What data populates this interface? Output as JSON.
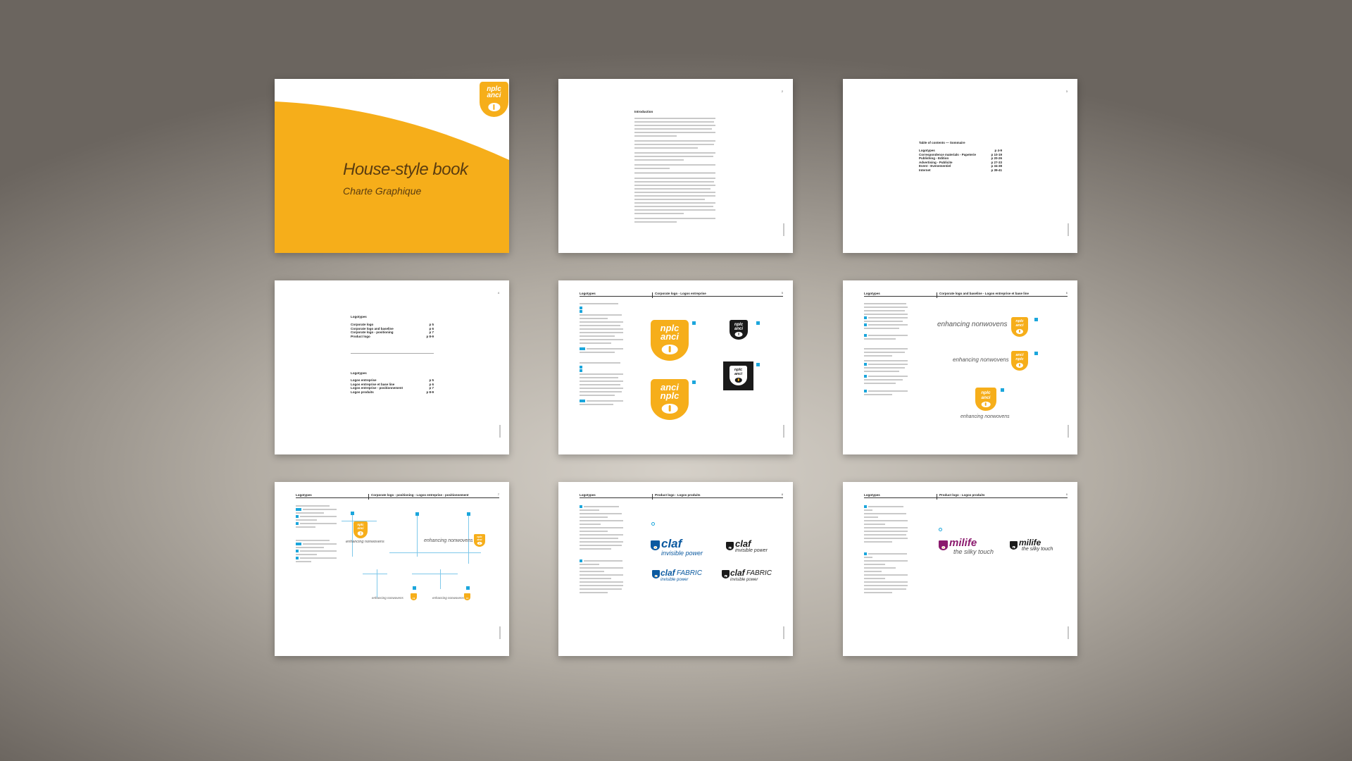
{
  "cover": {
    "title": "House-style book",
    "subtitle": "Charte Graphique",
    "logo_top": "nplc",
    "logo_bottom": "anci",
    "accent": "#f6ae1a"
  },
  "intro": {
    "page": "2",
    "heading": "Introduction"
  },
  "toc": {
    "page": "3",
    "heading": "Table of contents — Sommaire",
    "items": [
      {
        "label": "Logotypes",
        "pages": "p 4-9"
      },
      {
        "label": "Correspondence materials - Papeterie",
        "pages": "p 10-19"
      },
      {
        "label": "Publishing - Edition",
        "pages": "p 20-26"
      },
      {
        "label": "Advertising - Publicite",
        "pages": "p 27-33"
      },
      {
        "label": "Event - Evenementiel",
        "pages": "p 34-38"
      },
      {
        "label": "Internet",
        "pages": "p 39-41"
      }
    ]
  },
  "logotypes_index": {
    "page": "4",
    "heading_en": "Logotypes",
    "items_en": [
      {
        "label": "Corporate logo",
        "pages": "p 5"
      },
      {
        "label": "Corporate logo and baseline",
        "pages": "p 6"
      },
      {
        "label": "Corporate logo - positioning",
        "pages": "p 7"
      },
      {
        "label": "Product logo",
        "pages": "p 8-9"
      }
    ],
    "heading_fr": "Logotypes",
    "items_fr": [
      {
        "label": "Logos entreprise",
        "pages": "p 5"
      },
      {
        "label": "Logos entreprise et base line",
        "pages": "p 6"
      },
      {
        "label": "Logos entreprise - positionnement",
        "pages": "p 7"
      },
      {
        "label": "Logos produits",
        "pages": "p 8-9"
      }
    ]
  },
  "corporate": {
    "page": "5",
    "left": "Logotypes",
    "right": "Corporate logo - Logos entreprise",
    "logo_a_top": "nplc",
    "logo_a_bottom": "anci",
    "logo_b_top": "anci",
    "logo_b_bottom": "nplc"
  },
  "baseline": {
    "page": "6",
    "left": "Logotypes",
    "right": "Corporate logo and baseline - Logos entreprise et base line",
    "tagline": "enhancing nonwovens"
  },
  "positioning": {
    "page": "7",
    "left": "Logotypes",
    "right": "Corporate logo - positioning - Logos entreprise - positionnement",
    "tagline": "enhancing nonwovens"
  },
  "product1": {
    "page": "8",
    "left": "Logotypes",
    "right": "Product logo - Logos produits",
    "brand": "claf",
    "brand_sub": "invisible power",
    "brand_fabric": "FABRIC",
    "brand_color": "#0c5aa0"
  },
  "product2": {
    "page": "9",
    "left": "Logotypes",
    "right": "Product logo - Logos produits",
    "brand": "milife",
    "brand_sub": "the silky touch",
    "brand_color": "#8b1a6e"
  }
}
